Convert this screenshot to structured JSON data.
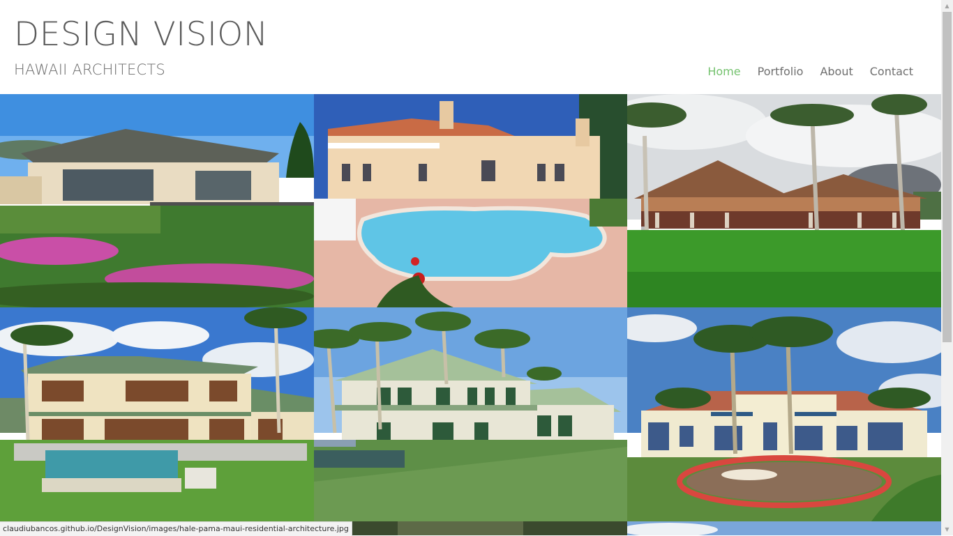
{
  "site": {
    "title": "DESIGN VISION",
    "subtitle": "HAWAII ARCHITECTS"
  },
  "nav": {
    "items": [
      {
        "label": "Home",
        "active": true
      },
      {
        "label": "Portfolio",
        "active": false
      },
      {
        "label": "About",
        "active": false
      },
      {
        "label": "Contact",
        "active": false
      }
    ]
  },
  "gallery": {
    "tiles": [
      {
        "name": "photo-tile-1",
        "icon": "hillside-residence-photo"
      },
      {
        "name": "photo-tile-2",
        "icon": "pool-villa-photo"
      },
      {
        "name": "photo-tile-3",
        "icon": "pavilion-palms-photo"
      },
      {
        "name": "photo-tile-4",
        "icon": "two-story-residence-render"
      },
      {
        "name": "photo-tile-5",
        "icon": "plantation-house-render"
      },
      {
        "name": "photo-tile-6",
        "icon": "estate-mansion-render"
      },
      {
        "name": "photo-tile-7",
        "icon": "partial-photo"
      },
      {
        "name": "photo-tile-8",
        "icon": "partial-photo"
      },
      {
        "name": "photo-tile-9",
        "icon": "partial-photo"
      }
    ]
  },
  "status": {
    "url": "claudiubancos.github.io/DesignVision/images/hale-pama-maui-residential-architecture.jpg"
  },
  "colors": {
    "accent": "#74c26e",
    "nav_text": "#6f6f6f",
    "title_text": "#5a5a5a"
  }
}
